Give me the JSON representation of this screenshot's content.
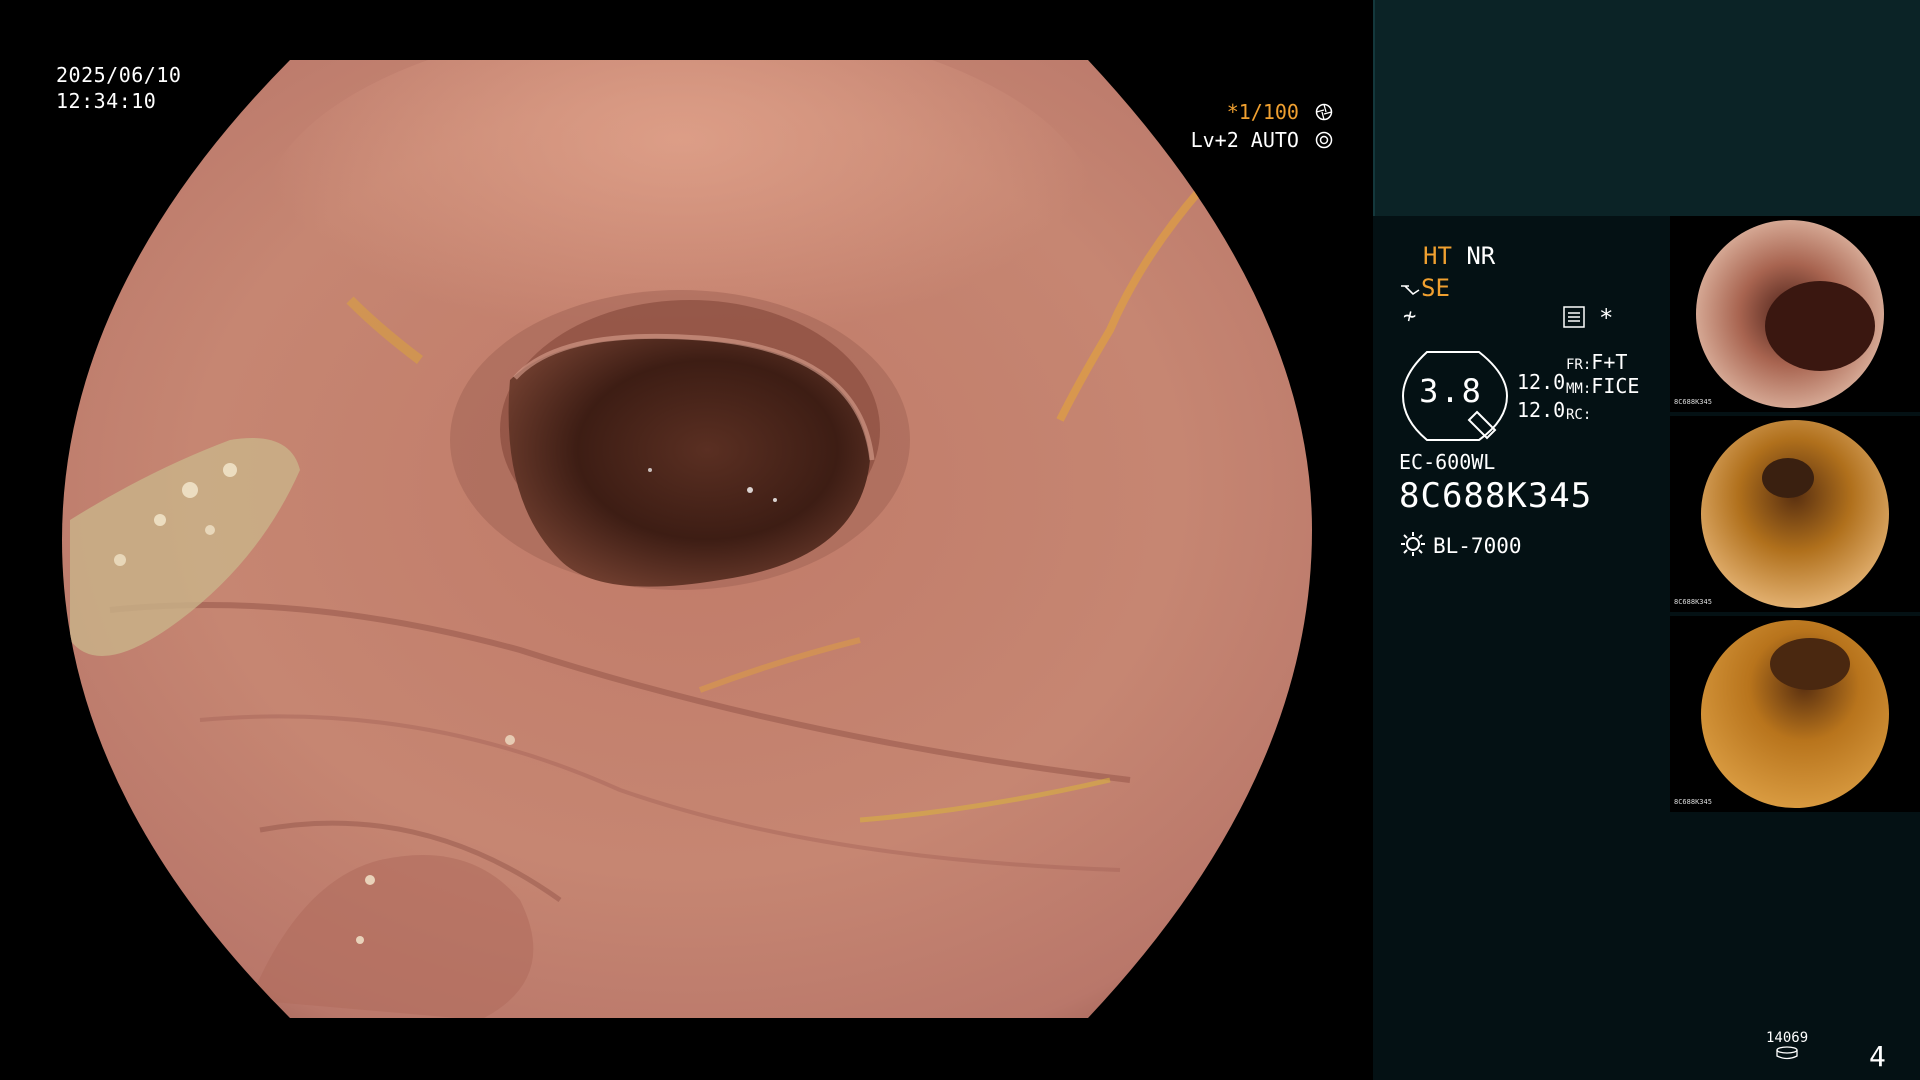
{
  "scope": {
    "date": "2025/06/10",
    "time": "12:34:10",
    "shutter": "*1/100",
    "shutter_icon": "shutter-icon",
    "iris_level": "Lv+2 AUTO",
    "iris_icon": "iris-icon"
  },
  "panel": {
    "ht": "HT",
    "nr": "NR",
    "se": "SE",
    "enhance_glyph": "≁",
    "menu_icon": "menu-icon",
    "star": "*",
    "gauge_value": "3.8",
    "value_a": "12.0",
    "value_b": "12.0",
    "fr_label": "FR:",
    "fr_value": "F+T",
    "mm_label": "MM:",
    "mm_value": "FICE",
    "rc_label": "RC:",
    "model": "EC-600WL",
    "serial": "8C688K345",
    "light_source": "BL-7000",
    "light_icon": "light-source-icon",
    "storage_count": "14069",
    "storage_icon": "storage-icon",
    "page": "4"
  },
  "thumbnails": [
    {
      "label": "thumbnail-1",
      "id": "8C688K345"
    },
    {
      "label": "thumbnail-2",
      "id": "8C688K345"
    },
    {
      "label": "thumbnail-3",
      "id": "8C688K345"
    }
  ],
  "colors": {
    "accent": "#f0a030",
    "panel_bg": "#041114",
    "panel_top": "#0b2326"
  }
}
